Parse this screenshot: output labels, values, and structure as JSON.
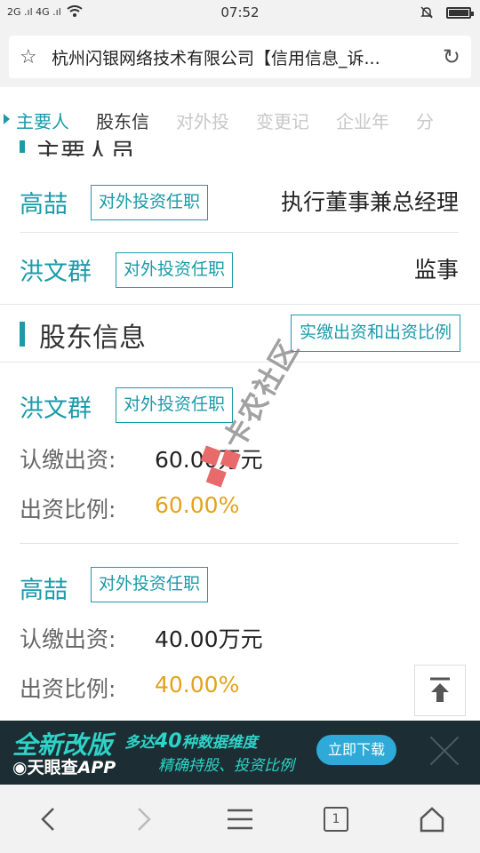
{
  "status": {
    "left_text": "2G .ıl 4G .ıl",
    "time": "07:52"
  },
  "browser": {
    "url_title": "杭州闪银网络技术有限公司【信用信息_诉...",
    "tab_count": "1"
  },
  "tabs": [
    {
      "label": "主要人"
    },
    {
      "label": "股东信"
    },
    {
      "label": "对外投"
    },
    {
      "label": "变更记"
    },
    {
      "label": "企业年"
    },
    {
      "label": "分"
    }
  ],
  "main_personnel": {
    "peek_title": "主要人员",
    "people": [
      {
        "name": "高喆",
        "button": "对外投资任职",
        "role": "执行董事兼总经理"
      },
      {
        "name": "洪文群",
        "button": "对外投资任职",
        "role": "监事"
      }
    ]
  },
  "shareholders": {
    "title": "股东信息",
    "header_button": "实缴出资和出资比例",
    "subscribed_label": "认缴出资:",
    "ratio_label": "出资比例:",
    "items": [
      {
        "name": "洪文群",
        "button": "对外投资任职",
        "subscribed": "60.00万元",
        "ratio": "60.00%"
      },
      {
        "name": "高喆",
        "button": "对外投资任职",
        "subscribed": "40.00万元",
        "ratio": "40.00%"
      }
    ]
  },
  "watermark": "卡农社区",
  "ad": {
    "headline": "全新改版",
    "brand": "天眼查",
    "brand_suffix": "APP",
    "line1_prefix": "多达",
    "line1_number": "40",
    "line1_suffix": "种数据维度",
    "line2": "精确持股、投资比例",
    "download_label": "立即下载"
  },
  "colors": {
    "accent": "#1a9ba8",
    "ratio": "#e3a21a"
  }
}
